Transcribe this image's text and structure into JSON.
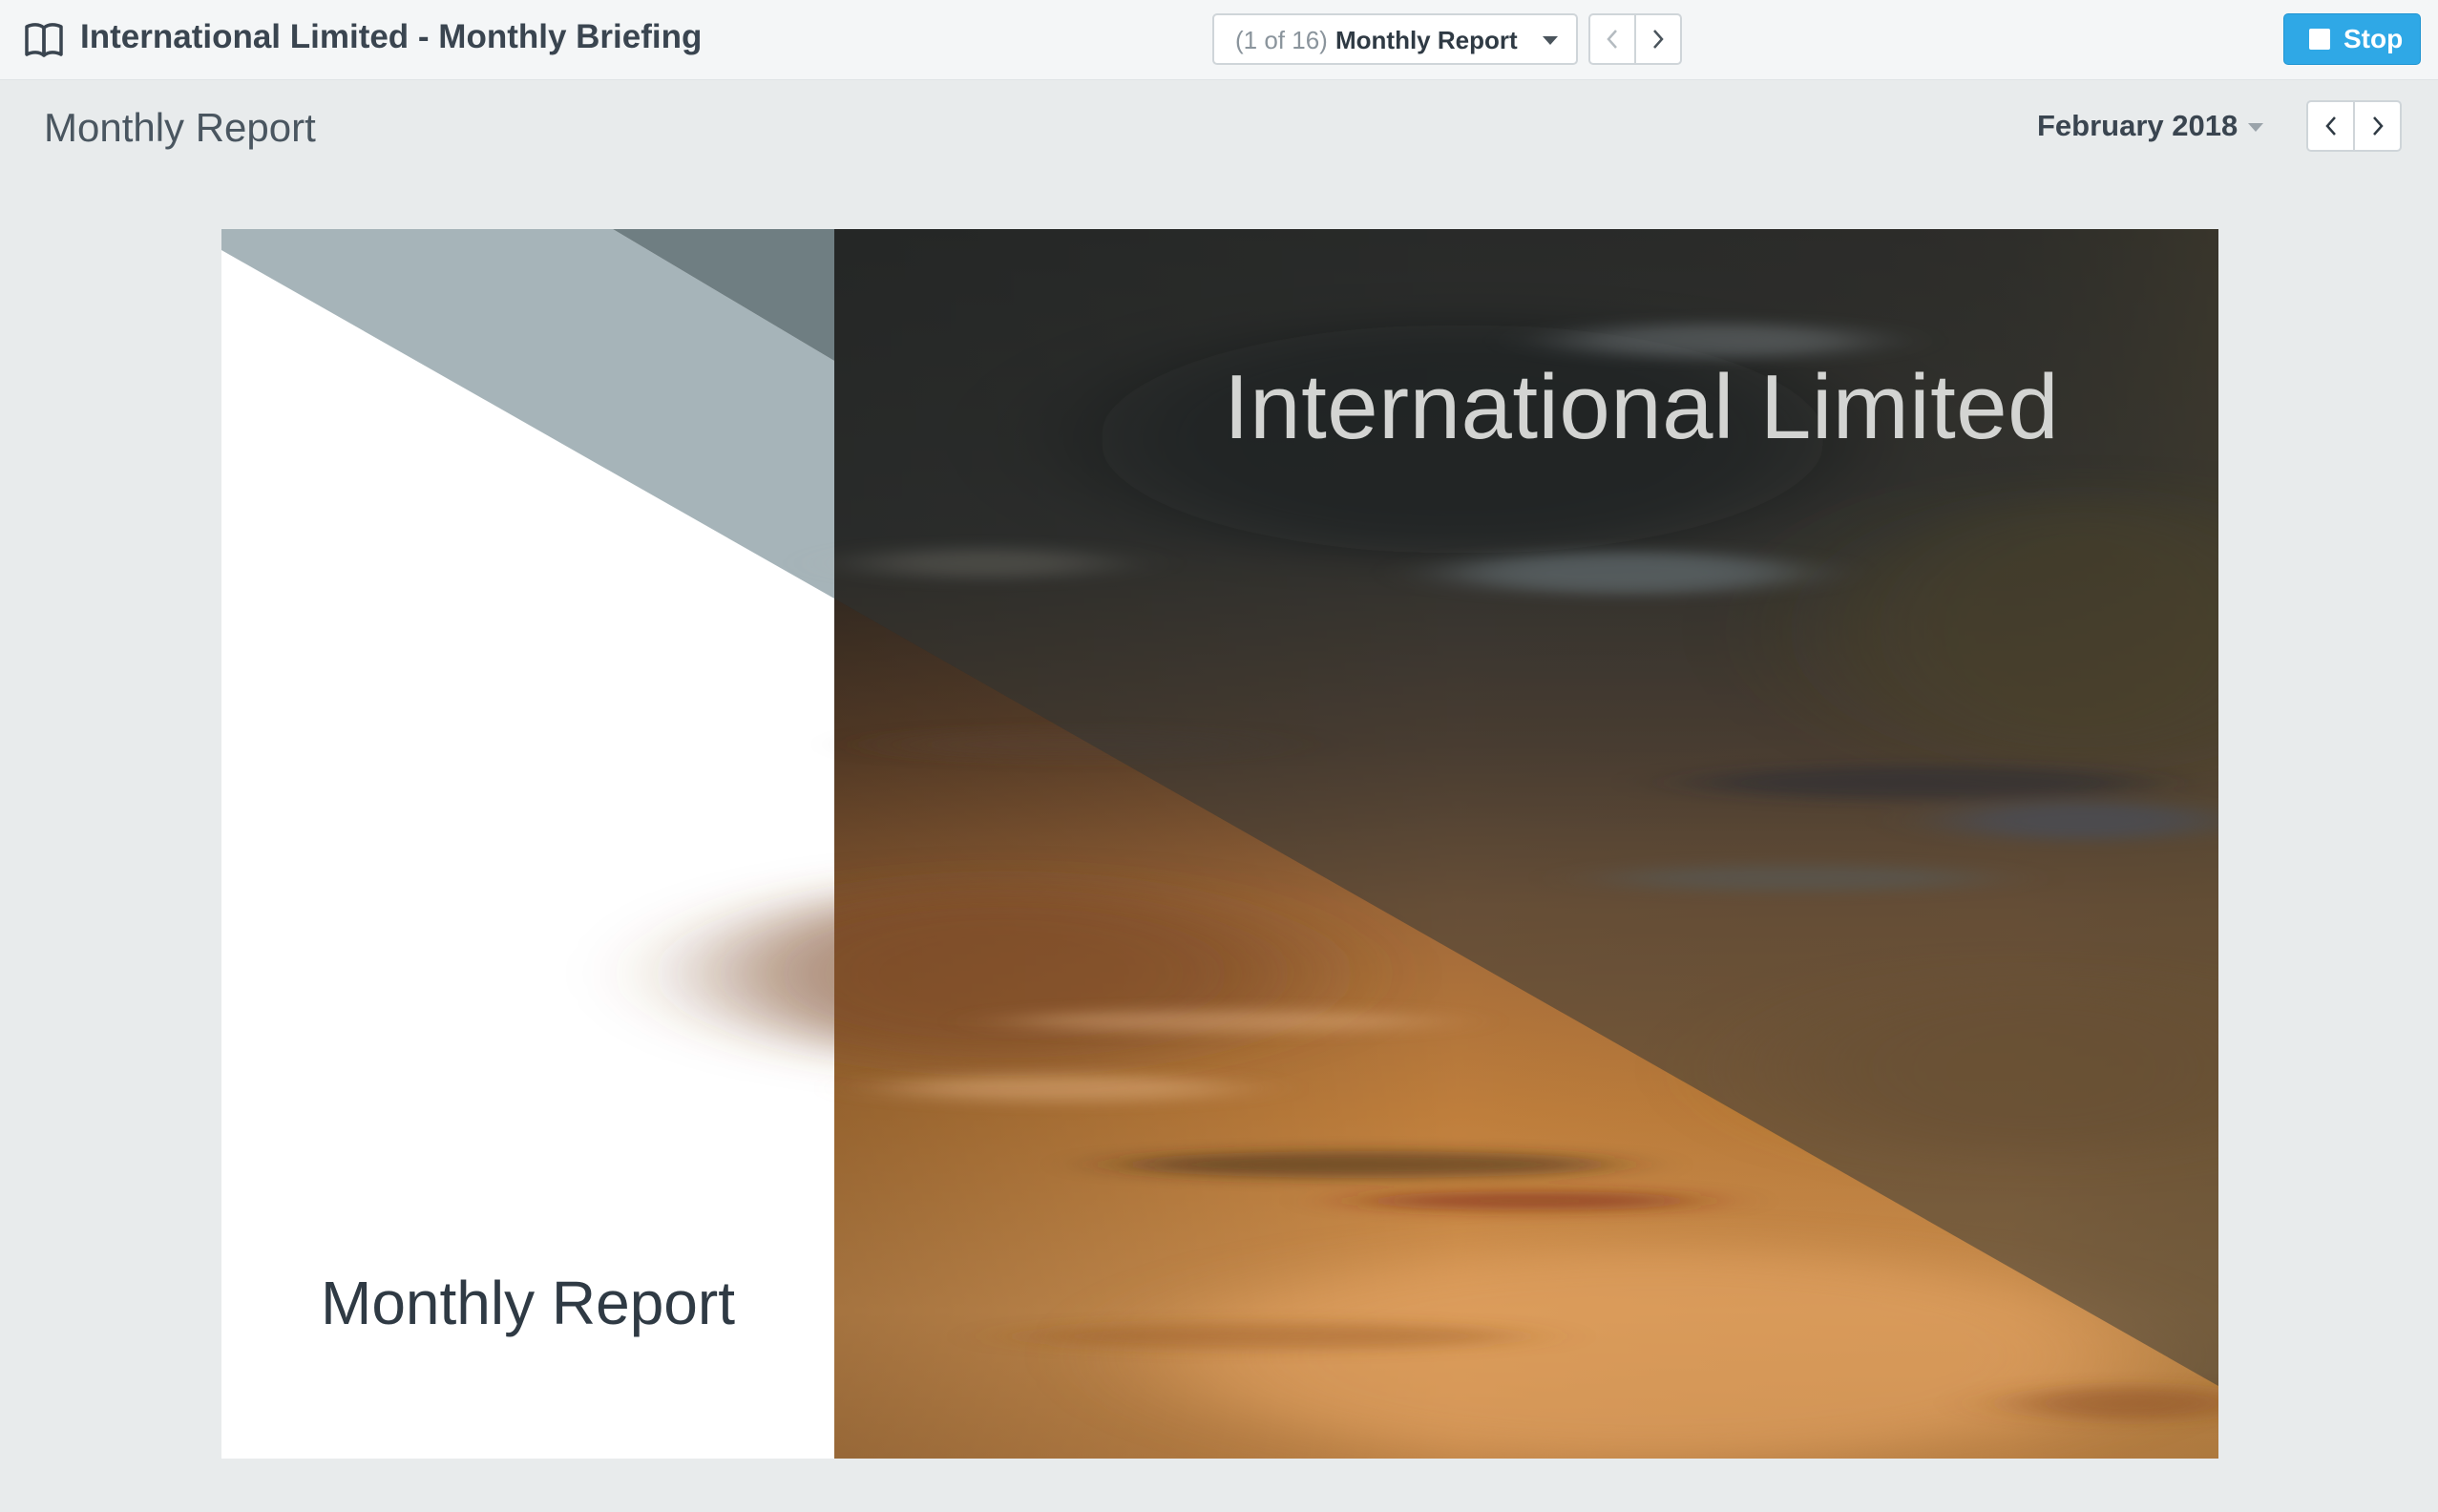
{
  "header": {
    "app_title": "International Limited - Monthly Briefing",
    "book_icon": "book-open-icon",
    "page_select": {
      "counter": "(1 of 16)",
      "current": "Monthly Report"
    },
    "stop_label": "Stop",
    "stop_icon": "square-stop-icon",
    "accent_color": "#2fa8e6"
  },
  "subheader": {
    "title": "Monthly Report",
    "period": "February 2018"
  },
  "slide": {
    "company": "International Limited",
    "subtitle": "Monthly Report"
  }
}
